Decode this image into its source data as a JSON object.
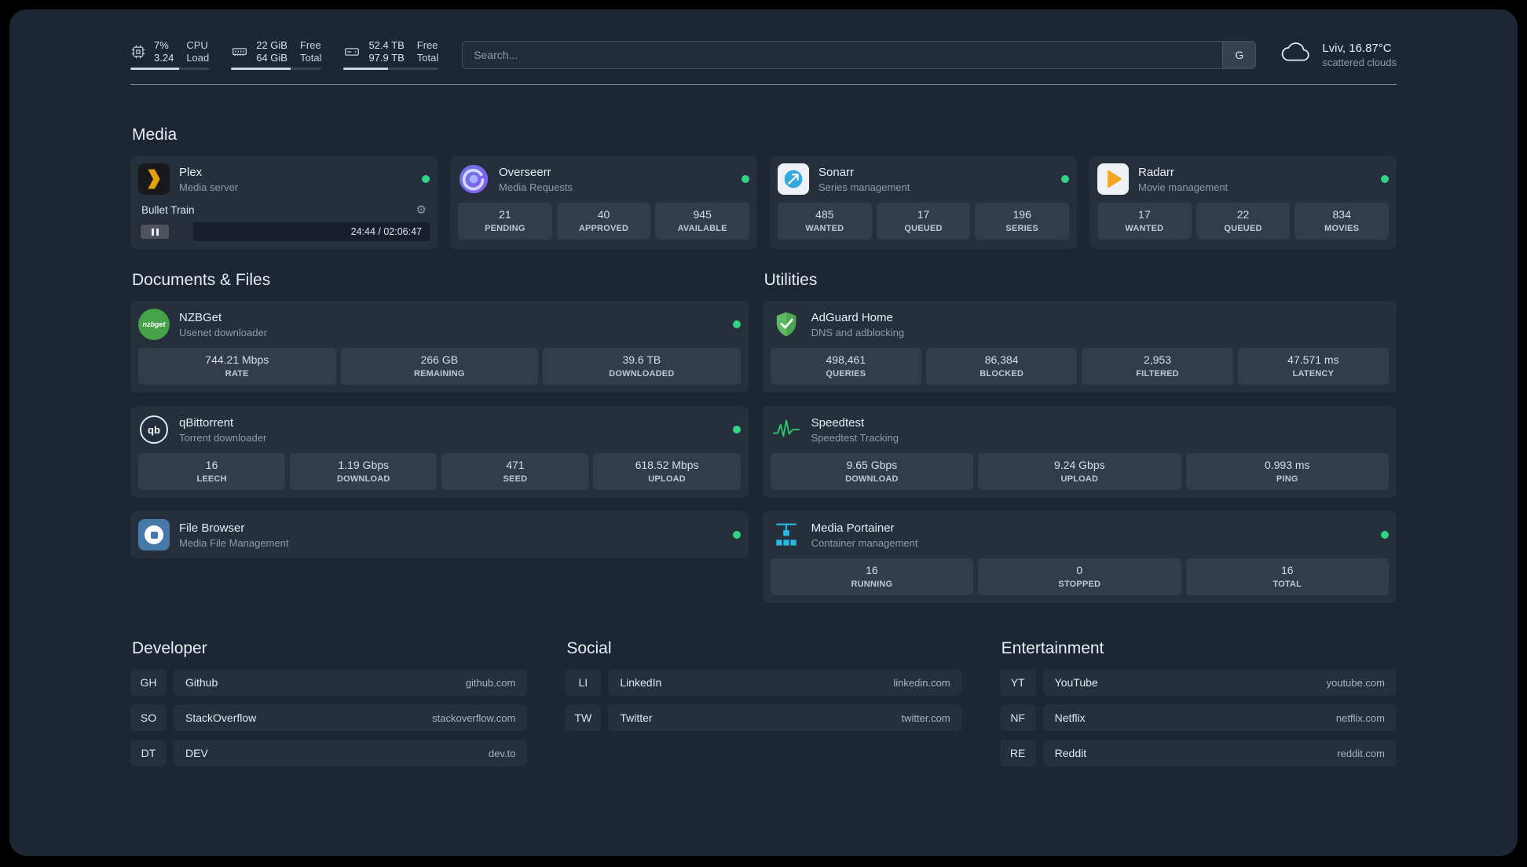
{
  "topbar": {
    "resources": [
      {
        "icon": "cpu-icon",
        "value_primary": "7%",
        "value_secondary": "3.24",
        "label_primary": "CPU",
        "label_secondary": "Load",
        "bar_pct": 62
      },
      {
        "icon": "memory-icon",
        "value_primary": "22 GiB",
        "value_secondary": "64 GiB",
        "label_primary": "Free",
        "label_secondary": "Total",
        "bar_pct": 66
      },
      {
        "icon": "disk-icon",
        "value_primary": "52.4 TB",
        "value_secondary": "97.9 TB",
        "label_primary": "Free",
        "label_secondary": "Total",
        "bar_pct": 47
      }
    ],
    "search": {
      "placeholder": "Search...",
      "button_label": "G"
    },
    "weather": {
      "icon": "cloud-icon",
      "location": "Lviv, 16.87°C",
      "condition": "scattered clouds"
    }
  },
  "media": {
    "title": "Media",
    "plex": {
      "icon": "plex-icon",
      "name": "Plex",
      "desc": "Media server",
      "now_playing": {
        "title": "Bullet Train",
        "time": "24:44 / 02:06:47",
        "progress_pct": 19
      }
    },
    "overseerr": {
      "icon": "overseerr-icon",
      "name": "Overseerr",
      "desc": "Media Requests",
      "stats": [
        {
          "value": "21",
          "label": "PENDING"
        },
        {
          "value": "40",
          "label": "APPROVED"
        },
        {
          "value": "945",
          "label": "AVAILABLE"
        }
      ]
    },
    "sonarr": {
      "icon": "sonarr-icon",
      "name": "Sonarr",
      "desc": "Series management",
      "stats": [
        {
          "value": "485",
          "label": "WANTED"
        },
        {
          "value": "17",
          "label": "QUEUED"
        },
        {
          "value": "196",
          "label": "SERIES"
        }
      ]
    },
    "radarr": {
      "icon": "radarr-icon",
      "name": "Radarr",
      "desc": "Movie management",
      "stats": [
        {
          "value": "17",
          "label": "WANTED"
        },
        {
          "value": "22",
          "label": "QUEUED"
        },
        {
          "value": "834",
          "label": "MOVIES"
        }
      ]
    }
  },
  "documents": {
    "title": "Documents & Files",
    "nzbget": {
      "icon": "nzbget-icon",
      "name": "NZBGet",
      "desc": "Usenet downloader",
      "stats": [
        {
          "value": "744.21 Mbps",
          "label": "RATE"
        },
        {
          "value": "266 GB",
          "label": "REMAINING"
        },
        {
          "value": "39.6 TB",
          "label": "DOWNLOADED"
        }
      ]
    },
    "qbittorrent": {
      "icon": "qbittorrent-icon",
      "name": "qBittorrent",
      "desc": "Torrent downloader",
      "stats": [
        {
          "value": "16",
          "label": "LEECH"
        },
        {
          "value": "1.19 Gbps",
          "label": "DOWNLOAD"
        },
        {
          "value": "471",
          "label": "SEED"
        },
        {
          "value": "618.52 Mbps",
          "label": "UPLOAD"
        }
      ]
    },
    "filebrowser": {
      "icon": "filebrowser-icon",
      "name": "File Browser",
      "desc": "Media File Management"
    }
  },
  "utilities": {
    "title": "Utilities",
    "adguard": {
      "icon": "adguard-icon",
      "name": "AdGuard Home",
      "desc": "DNS and adblocking",
      "stats": [
        {
          "value": "498,461",
          "label": "QUERIES"
        },
        {
          "value": "86,384",
          "label": "BLOCKED"
        },
        {
          "value": "2,953",
          "label": "FILTERED"
        },
        {
          "value": "47.571 ms",
          "label": "LATENCY"
        }
      ]
    },
    "speedtest": {
      "icon": "speedtest-icon",
      "name": "Speedtest",
      "desc": "Speedtest Tracking",
      "stats": [
        {
          "value": "9.65 Gbps",
          "label": "DOWNLOAD"
        },
        {
          "value": "9.24 Gbps",
          "label": "UPLOAD"
        },
        {
          "value": "0.993 ms",
          "label": "PING"
        }
      ]
    },
    "portainer": {
      "icon": "portainer-icon",
      "name": "Media Portainer",
      "desc": "Container management",
      "stats": [
        {
          "value": "16",
          "label": "RUNNING"
        },
        {
          "value": "0",
          "label": "STOPPED"
        },
        {
          "value": "16",
          "label": "TOTAL"
        }
      ]
    }
  },
  "bookmarks": {
    "developer": {
      "title": "Developer",
      "items": [
        {
          "abbr": "GH",
          "name": "Github",
          "url": "github.com"
        },
        {
          "abbr": "SO",
          "name": "StackOverflow",
          "url": "stackoverflow.com"
        },
        {
          "abbr": "DT",
          "name": "DEV",
          "url": "dev.to"
        }
      ]
    },
    "social": {
      "title": "Social",
      "items": [
        {
          "abbr": "LI",
          "name": "LinkedIn",
          "url": "linkedin.com"
        },
        {
          "abbr": "TW",
          "name": "Twitter",
          "url": "twitter.com"
        }
      ]
    },
    "entertainment": {
      "title": "Entertainment",
      "items": [
        {
          "abbr": "YT",
          "name": "YouTube",
          "url": "youtube.com"
        },
        {
          "abbr": "NF",
          "name": "Netflix",
          "url": "netflix.com"
        },
        {
          "abbr": "RE",
          "name": "Reddit",
          "url": "reddit.com"
        }
      ]
    }
  },
  "colors": {
    "status_green": "#2fd484",
    "plex_amber": "#e5a00d",
    "background": "#1d2634"
  }
}
